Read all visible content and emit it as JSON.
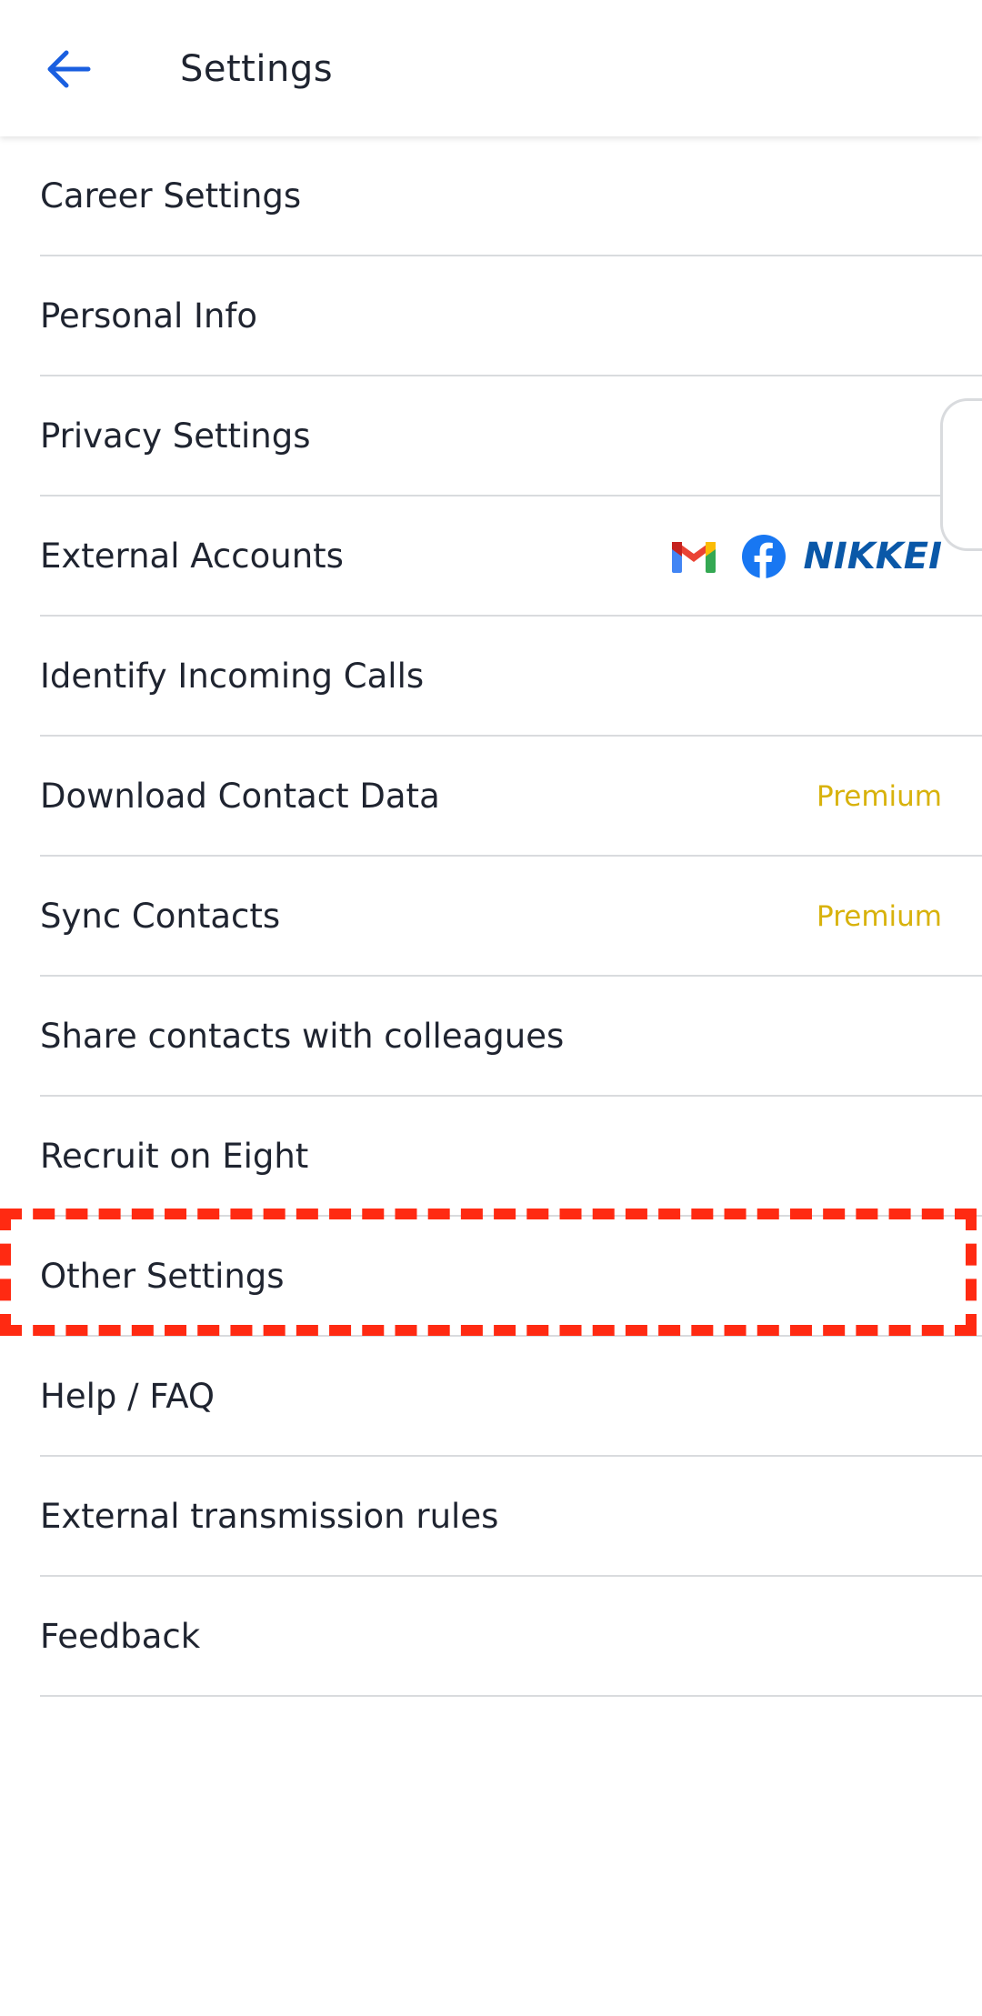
{
  "header": {
    "title": "Settings",
    "back_icon": "arrow-left-icon"
  },
  "colors": {
    "accent": "#1a5fe0",
    "premium": "#d8b20c",
    "divider": "#d9dbde",
    "highlight": "#ff2a12",
    "nikkei": "#0a58a8",
    "facebook": "#1877f2"
  },
  "settings": {
    "items": [
      {
        "label": "Career Settings"
      },
      {
        "label": "Personal Info"
      },
      {
        "label": "Privacy Settings"
      },
      {
        "label": "External Accounts",
        "accounts": [
          "gmail-icon",
          "facebook-icon",
          "NIKKEI"
        ]
      },
      {
        "label": "Identify Incoming Calls"
      },
      {
        "label": "Download Contact Data",
        "badge": "Premium"
      },
      {
        "label": "Sync Contacts",
        "badge": "Premium"
      },
      {
        "label": "Share contacts with colleagues"
      },
      {
        "label": "Recruit on Eight"
      },
      {
        "label": "Other Settings",
        "highlighted": true
      },
      {
        "label": "Help / FAQ"
      },
      {
        "label": "External transmission rules"
      },
      {
        "label": "Feedback"
      }
    ]
  }
}
